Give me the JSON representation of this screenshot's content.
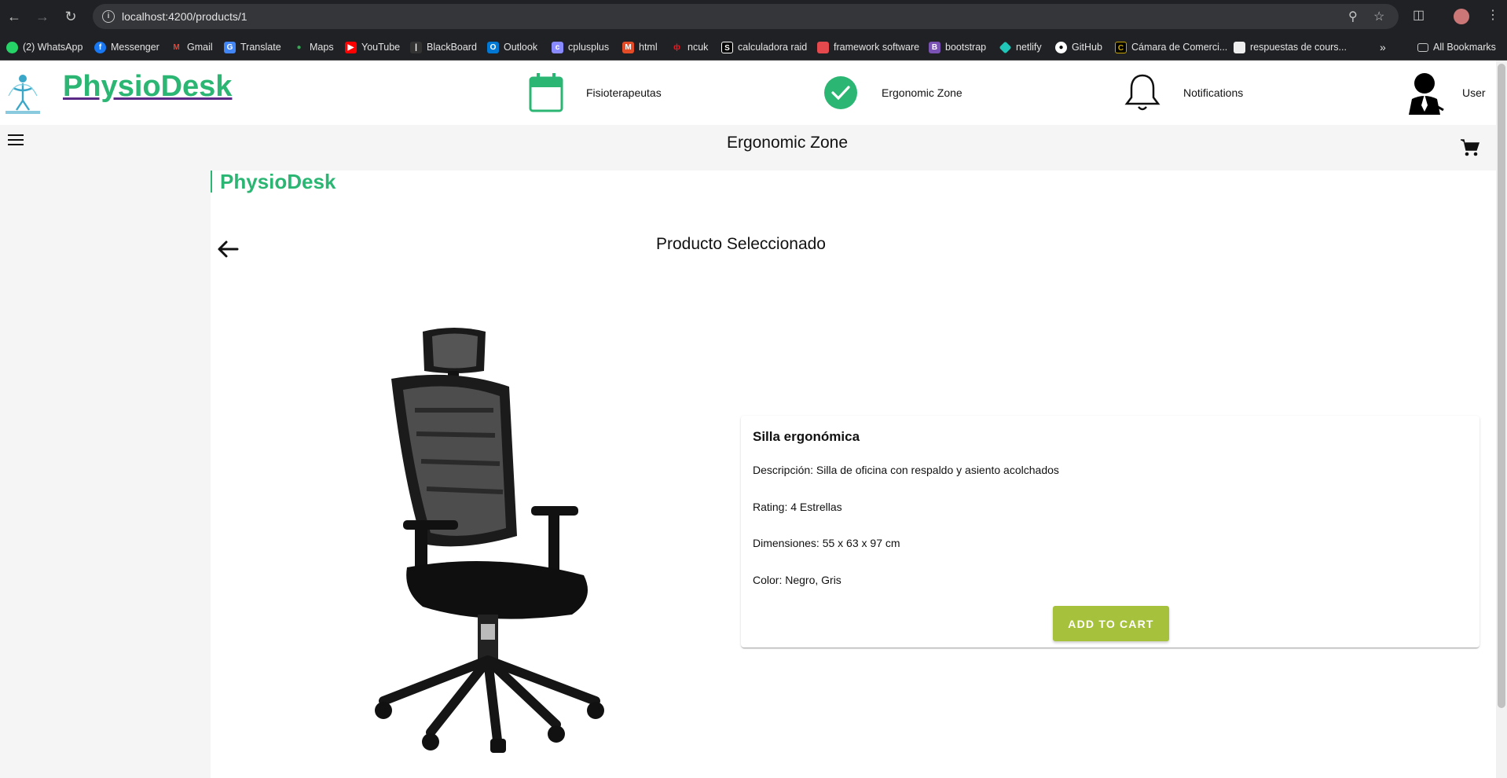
{
  "browser": {
    "url": "localhost:4200/products/1",
    "bookmarks": [
      {
        "label": "(2) WhatsApp",
        "icon": "whatsapp-icon",
        "color": "#25d366"
      },
      {
        "label": "Messenger",
        "icon": "facebook-icon",
        "color": "#1877f2"
      },
      {
        "label": "Gmail",
        "icon": "gmail-icon",
        "color": "#ea4335"
      },
      {
        "label": "Translate",
        "icon": "translate-icon",
        "color": "#4285f4"
      },
      {
        "label": "Maps",
        "icon": "maps-icon",
        "color": "#34a853"
      },
      {
        "label": "YouTube",
        "icon": "youtube-icon",
        "color": "#ff0000"
      },
      {
        "label": "BlackBoard",
        "icon": "blackboard-icon",
        "color": "#333333"
      },
      {
        "label": "Outlook",
        "icon": "outlook-icon",
        "color": "#0078d4"
      },
      {
        "label": "cplusplus",
        "icon": "cplusplus-icon",
        "color": "#8a8aff"
      },
      {
        "label": "html",
        "icon": "html-icon",
        "color": "#e34c26"
      },
      {
        "label": "ncuk",
        "icon": "ncuk-icon",
        "color": "#e31b23"
      },
      {
        "label": "calculadora raid",
        "icon": "calculadora-icon",
        "color": "#000000"
      },
      {
        "label": "framework software",
        "icon": "framework-icon",
        "color": "#e5484d"
      },
      {
        "label": "bootstrap",
        "icon": "bootstrap-icon",
        "color": "#7952b3"
      },
      {
        "label": "netlify",
        "icon": "netlify-icon",
        "color": "#20c6b7"
      },
      {
        "label": "GitHub",
        "icon": "github-icon",
        "color": "#ffffff"
      },
      {
        "label": "Cámara de Comerci...",
        "icon": "camara-icon",
        "color": "#c8a600"
      },
      {
        "label": "respuestas de cours...",
        "icon": "document-icon",
        "color": "#9e9e9e"
      }
    ],
    "all_bookmarks": "All Bookmarks"
  },
  "header": {
    "brand": "PhysioDesk",
    "nav": [
      {
        "label": "Fisioterapeutas",
        "icon": "calendar-icon"
      },
      {
        "label": "Ergonomic Zone",
        "icon": "check-circle-icon"
      },
      {
        "label": "Notifications",
        "icon": "bell-icon"
      },
      {
        "label": "User",
        "icon": "user-avatar-icon"
      }
    ]
  },
  "toolbar": {
    "title": "Ergonomic Zone"
  },
  "main": {
    "sub_brand": "PhysioDesk",
    "heading": "Producto Seleccionado",
    "product": {
      "name": "Silla ergonómica",
      "description": "Descripción: Silla de oficina con respaldo y asiento acolchados",
      "rating": "Rating: 4 Estrellas",
      "dimensions": "Dimensiones: 55 x 63 x 97 cm",
      "color": "Color: Negro, Gris",
      "add_to_cart": "ADD TO CART"
    }
  },
  "colors": {
    "brand_green": "#2bb673",
    "button_green": "#a6c13b"
  }
}
